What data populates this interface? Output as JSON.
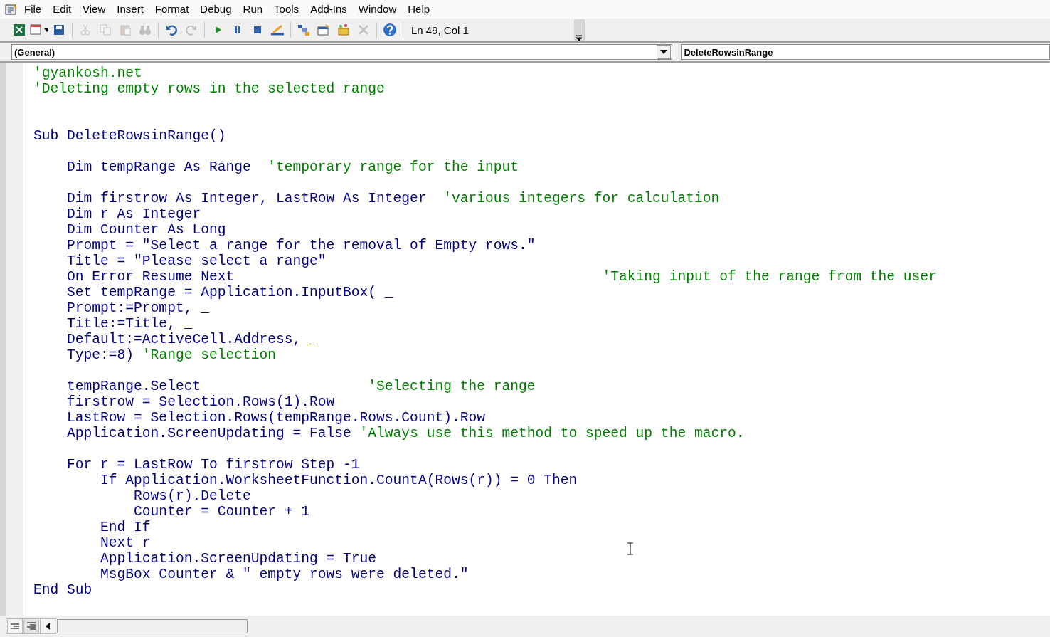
{
  "menu_bar": {
    "items": [
      {
        "key": "F",
        "post": "ile"
      },
      {
        "key": "E",
        "post": "dit"
      },
      {
        "key": "V",
        "post": "iew"
      },
      {
        "key": "I",
        "post": "nsert"
      },
      {
        "pre": "F",
        "key": "o",
        "post": "rmat"
      },
      {
        "key": "D",
        "post": "ebug"
      },
      {
        "key": "R",
        "post": "un"
      },
      {
        "key": "T",
        "post": "ools"
      },
      {
        "key": "A",
        "post": "dd-Ins"
      },
      {
        "key": "W",
        "post": "indow"
      },
      {
        "key": "H",
        "post": "elp"
      }
    ]
  },
  "toolbar": {
    "items": [
      {
        "kind": "excel",
        "enabled": true
      },
      {
        "kind": "insert",
        "enabled": true
      },
      {
        "kind": "save",
        "enabled": true
      },
      {
        "kind": "sep"
      },
      {
        "kind": "cut",
        "enabled": false
      },
      {
        "kind": "copy",
        "enabled": false
      },
      {
        "kind": "paste",
        "enabled": false
      },
      {
        "kind": "find",
        "enabled": false
      },
      {
        "kind": "sep"
      },
      {
        "kind": "undo",
        "enabled": true
      },
      {
        "kind": "redo",
        "enabled": false
      },
      {
        "kind": "sep"
      },
      {
        "kind": "run",
        "enabled": true
      },
      {
        "kind": "pause",
        "enabled": true
      },
      {
        "kind": "stop",
        "enabled": true
      },
      {
        "kind": "design",
        "enabled": true
      },
      {
        "kind": "sep"
      },
      {
        "kind": "project",
        "enabled": true
      },
      {
        "kind": "properties",
        "enabled": true
      },
      {
        "kind": "objects",
        "enabled": true
      },
      {
        "kind": "tools",
        "enabled": false
      },
      {
        "kind": "sep"
      },
      {
        "kind": "help",
        "enabled": true
      },
      {
        "kind": "sep"
      }
    ],
    "position": "Ln 49, Col 1"
  },
  "object_combo": {
    "value": "(General)"
  },
  "procedure_combo": {
    "value": "DeleteRowsinRange"
  },
  "code_lines": [
    {
      "kind": "code",
      "comment": "'gyankosh.net"
    },
    {
      "kind": "code",
      "comment": "'Deleting empty rows in the selected range"
    },
    {
      "kind": "blank"
    },
    {
      "kind": "blank"
    },
    {
      "kind": "code",
      "code": "Sub DeleteRowsinRange()"
    },
    {
      "kind": "blank"
    },
    {
      "kind": "code",
      "code": "    Dim tempRange As Range  ",
      "comment": "'temporary range for the input"
    },
    {
      "kind": "blank"
    },
    {
      "kind": "code",
      "code": "    Dim firstrow As Integer, LastRow As Integer  ",
      "comment": "'various integers for calculation"
    },
    {
      "kind": "code",
      "code": "    Dim r As Integer"
    },
    {
      "kind": "code",
      "code": "    Dim Counter As Long"
    },
    {
      "kind": "code",
      "code": "    Prompt = \"Select a range for the removal of Empty rows.\""
    },
    {
      "kind": "code",
      "code": "    Title = \"Please select a range\""
    },
    {
      "kind": "code",
      "code": "    On Error Resume Next                                            ",
      "comment": "'Taking input of the range from the user"
    },
    {
      "kind": "code",
      "code": "    Set tempRange = Application.InputBox( _"
    },
    {
      "kind": "code",
      "code": "    Prompt:=Prompt, _"
    },
    {
      "kind": "code",
      "code": "    Title:=Title, _"
    },
    {
      "kind": "code",
      "code": "    Default:=ActiveCell.Address, _"
    },
    {
      "kind": "code",
      "code": "    Type:=8) ",
      "comment": "'Range selection"
    },
    {
      "kind": "blank"
    },
    {
      "kind": "code",
      "code": "    tempRange.Select                    ",
      "comment": "'Selecting the range"
    },
    {
      "kind": "code",
      "code": "    firstrow = Selection.Rows(1).Row"
    },
    {
      "kind": "code",
      "code": "    LastRow = Selection.Rows(tempRange.Rows.Count).Row"
    },
    {
      "kind": "code",
      "code": "    Application.ScreenUpdating = False ",
      "comment": "'Always use this method to speed up the macro."
    },
    {
      "kind": "blank"
    },
    {
      "kind": "code",
      "code": "    For r = LastRow To firstrow Step -1"
    },
    {
      "kind": "code",
      "code": "        If Application.WorksheetFunction.CountA(Rows(r)) = 0 Then"
    },
    {
      "kind": "code",
      "code": "            Rows(r).Delete"
    },
    {
      "kind": "code",
      "code": "            Counter = Counter + 1"
    },
    {
      "kind": "code",
      "code": "        End If"
    },
    {
      "kind": "code",
      "code": "        Next r"
    },
    {
      "kind": "code",
      "code": "        Application.ScreenUpdating = True"
    },
    {
      "kind": "code",
      "code": "        MsgBox Counter & \" empty rows were deleted.\""
    },
    {
      "kind": "code",
      "code": "End Sub"
    }
  ]
}
